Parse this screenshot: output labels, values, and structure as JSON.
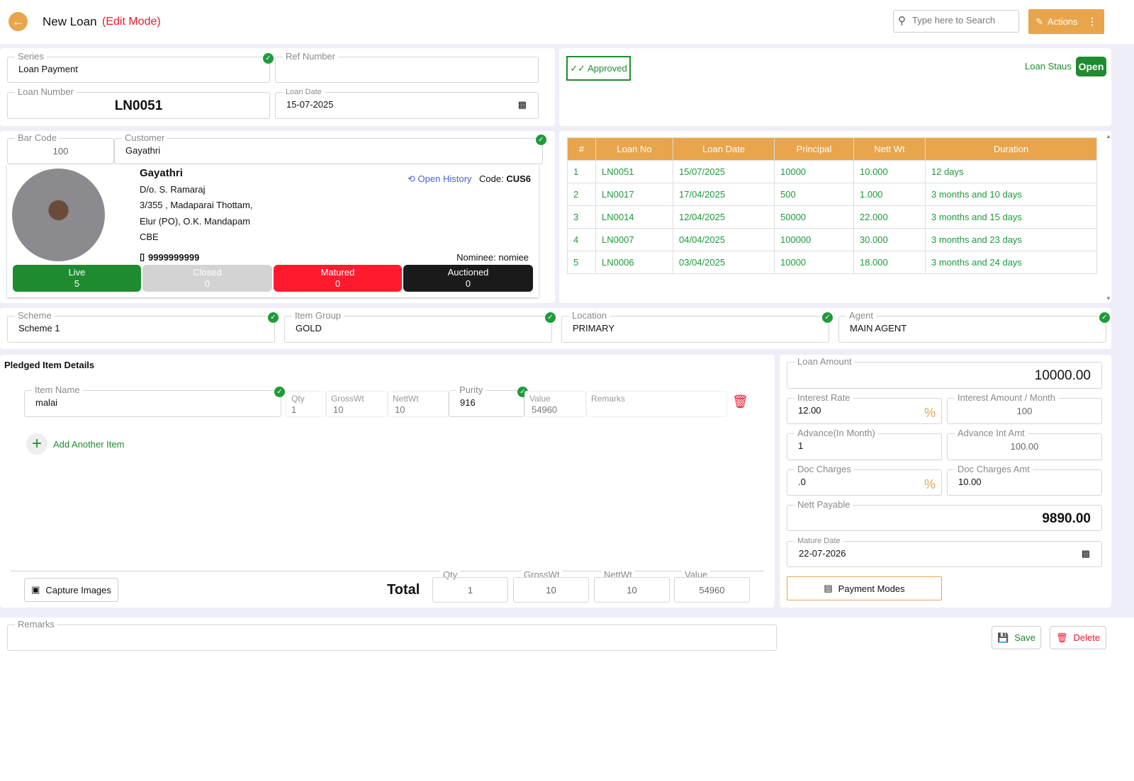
{
  "header": {
    "title": "New Loan",
    "mode": "(Edit Mode)",
    "search_placeholder": "Type here to Search",
    "actions_label": "Actions"
  },
  "form": {
    "series_label": "Series",
    "series": "Loan Payment",
    "ref_label": "Ref Number",
    "ref": "",
    "loan_number_label": "Loan Number",
    "loan_number": "LN0051",
    "loan_date_label": "Loan Date",
    "loan_date": "15-07-2025"
  },
  "status": {
    "approved": "Approved",
    "loan_status_label": "Loan Staus",
    "loan_status": "Open"
  },
  "customer": {
    "barcode_label": "Bar Code",
    "barcode": "100",
    "customer_label": "Customer",
    "customer": "Gayathri",
    "name": "Gayathri",
    "relation": "D/o. S. Ramaraj",
    "address1": "3/355 , Madaparai Thottam,",
    "address2": "Elur (PO), O.K. Mandapam",
    "city": "CBE",
    "phone": "9999999999",
    "open_history": "Open History",
    "code_label": "Code:",
    "code": "CUS6",
    "nominee": "Nominee: nomiee",
    "stats": [
      {
        "label": "Live",
        "count": "5",
        "color": "#1e8c2e"
      },
      {
        "label": "Closed",
        "count": "0",
        "color": "#d3d3d3"
      },
      {
        "label": "Matured",
        "count": "0",
        "color": "#ff1a2e"
      },
      {
        "label": "Auctioned",
        "count": "0",
        "color": "#1a1a1a"
      }
    ]
  },
  "history": {
    "headers": [
      "#",
      "Loan No",
      "Loan Date",
      "Principal",
      "Nett Wt",
      "Duration"
    ],
    "rows": [
      [
        "1",
        "LN0051",
        "15/07/2025",
        "10000",
        "10.000",
        "12 days"
      ],
      [
        "2",
        "LN0017",
        "17/04/2025",
        "500",
        "1.000",
        "3 months and 10 days"
      ],
      [
        "3",
        "LN0014",
        "12/04/2025",
        "50000",
        "22.000",
        "3 months and 15 days"
      ],
      [
        "4",
        "LN0007",
        "04/04/2025",
        "100000",
        "30.000",
        "3 months and 23 days"
      ],
      [
        "5",
        "LN0006",
        "03/04/2025",
        "10000",
        "18.000",
        "3 months and 24 days"
      ]
    ]
  },
  "scheme": {
    "scheme_label": "Scheme",
    "scheme": "Scheme 1",
    "group_label": "Item Group",
    "group": "GOLD",
    "location_label": "Location",
    "location": "PRIMARY",
    "agent_label": "Agent",
    "agent": "MAIN AGENT"
  },
  "items": {
    "title": "Pledged Item Details",
    "item_name_label": "Item Name",
    "item_name": "malai",
    "qty_label": "Qty",
    "qty": "1",
    "gross_label": "GrossWt",
    "gross": "10",
    "nett_label": "NettWt",
    "nett": "10",
    "purity_label": "Purity",
    "purity": "916",
    "value_label": "Value",
    "value": "54960",
    "remarks_label": "Remarks",
    "add_item": "Add Another Item",
    "capture": "Capture Images",
    "total": "Total",
    "tot_qty": "1",
    "tot_gross": "10",
    "tot_nett": "10",
    "tot_value": "54960"
  },
  "loan": {
    "amount_label": "Loan Amount",
    "amount": "10000.00",
    "rate_label": "Interest Rate",
    "rate": "12.00",
    "int_month_label": "Interest Amount / Month",
    "int_month": "100",
    "adv_label": "Advance(In Month)",
    "adv": "1",
    "adv_amt_label": "Advance Int Amt",
    "adv_amt": "100.00",
    "doc_label": "Doc Charges",
    "doc": ".0",
    "doc_amt_label": "Doc Charges Amt",
    "doc_amt": "10.00",
    "nett_label": "Nett Payable",
    "nett": "9890.00",
    "mature_label": "Mature Date",
    "mature": "22-07-2026",
    "payment_modes": "Payment Modes"
  },
  "footer": {
    "remarks_label": "Remarks",
    "remarks": "",
    "save": "Save",
    "delete": "Delete"
  }
}
